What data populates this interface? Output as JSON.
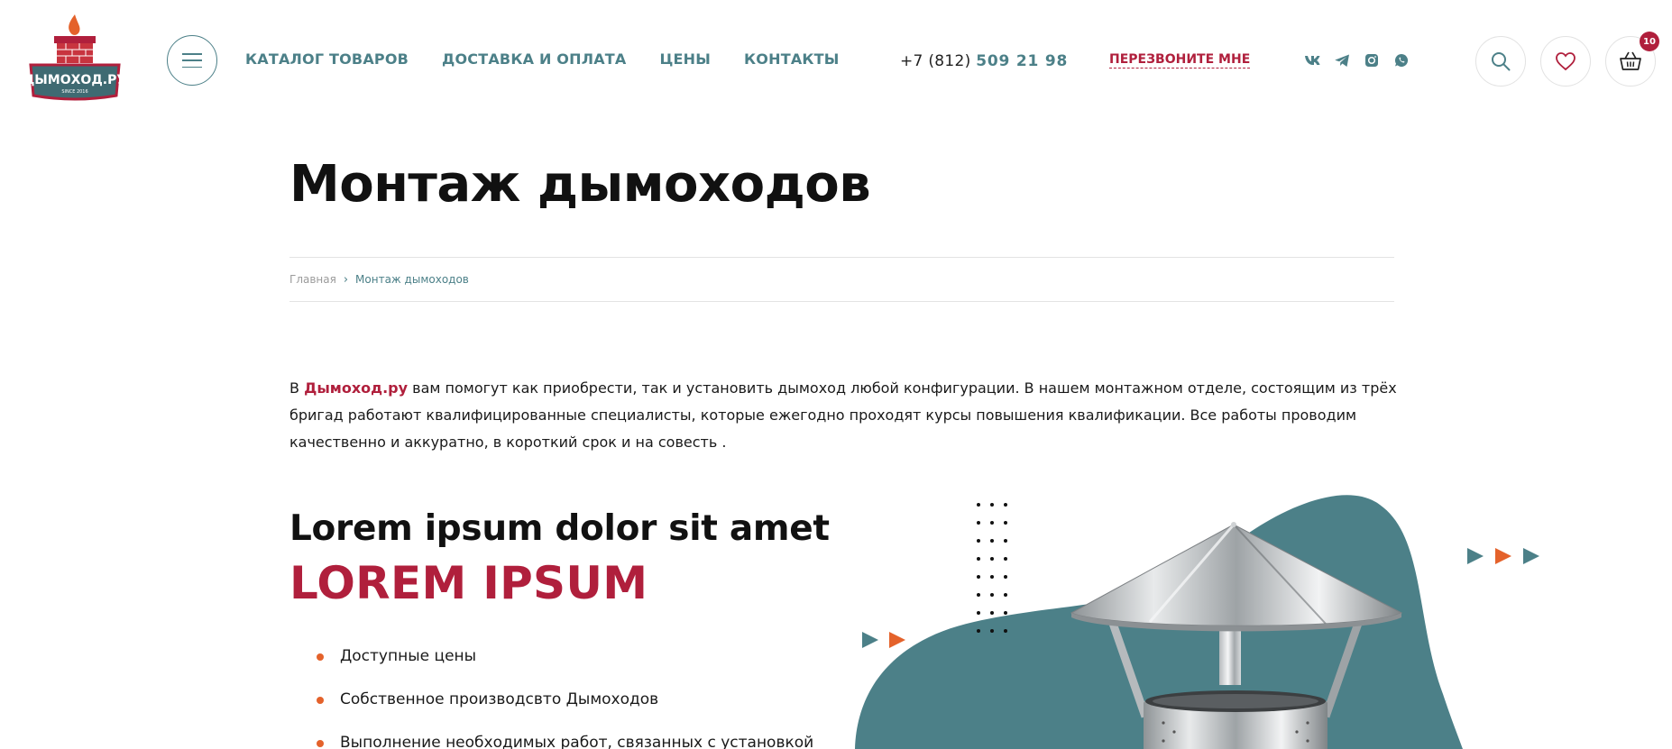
{
  "header": {
    "logo": {
      "text": "ДЫМОХОД.РУ",
      "since": "SINCE 2016"
    },
    "menu_aria": "menu",
    "nav": [
      {
        "label": "КАТАЛОГ ТОВАРОВ"
      },
      {
        "label": "ДОСТАВКА И ОПЛАТА"
      },
      {
        "label": "ЦЕНЫ"
      },
      {
        "label": "КОНТАКТЫ"
      }
    ],
    "phone_prefix": "+7 (812)",
    "phone_main": "509 21 98",
    "callback_label": "ПЕРЕЗВОНИТЕ МНЕ",
    "socials": [
      "vk-icon",
      "telegram-icon",
      "instagram-icon",
      "whatsapp-icon"
    ],
    "cart_count": "10"
  },
  "page": {
    "title": "Монтаж дымоходов",
    "breadcrumbs": {
      "home": "Главная",
      "current": "Монтаж дымоходов"
    }
  },
  "intro": {
    "prefix": "В ",
    "brand": "Дымоход.ру",
    "text": " вам помогут как приобрести, так и установить дымоход любой конфигурации. В нашем монтажном отделе, состоящим из трёх бригад работают квалифицированные специалисты, которые ежегодно проходят курсы повышения квалификации. Все работы проводим качественно и аккуратно, в короткий срок и на совесть ."
  },
  "features": {
    "title": "Lorem ipsum dolor sit amet",
    "subtitle": "LOREM IPSUM",
    "items": [
      {
        "label": "Доступные цены"
      },
      {
        "label": "Собственное производсвто  Дымоходов"
      },
      {
        "label": "Выполнение необходимых работ, связанных с установкой"
      }
    ]
  },
  "colors": {
    "accent_teal": "#4c8088",
    "accent_red": "#b01f3c",
    "bullet_orange": "#e4622b"
  }
}
